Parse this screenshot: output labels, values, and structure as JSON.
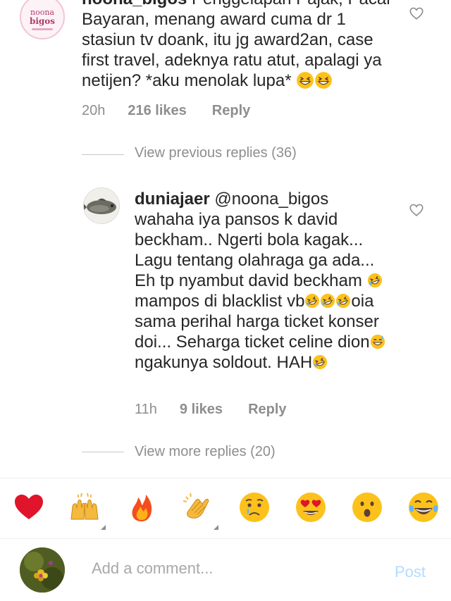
{
  "comment1": {
    "username": "noona_bigos",
    "avatar_text_top": "noona",
    "avatar_text_bottom": "bigos",
    "text": " Penggelapan Pajak, Pacar Bayaran, menang award cuma dr 1 stasiun tv doank, itu jg award2an, case first travel, adeknya ratu atut, apalagi ya netijen? *aku menolak lupa* ",
    "emojis": [
      "grinning-squint-face",
      "grinning-squint-face"
    ],
    "time": "20h",
    "likes": "216 likes",
    "reply": "Reply"
  },
  "view_previous": "View previous replies (36)",
  "reply1": {
    "username": "duniajaer",
    "mention": "@noona_bigos",
    "seg1": "wahaha iya pansos k david beckham.. Ngerti bola kagak... Lagu tentang olahraga ga ada... Eh tp nyambut david beckham ",
    "seg2": " mampos di blacklist vb",
    "seg3": "oia sama perihal harga ticket konser doi... Seharga ticket celine dion",
    "seg4": " ngakunya soldout.  HAH",
    "time": "11h",
    "likes": "9 likes",
    "reply": "Reply"
  },
  "view_more": "View more replies (20)",
  "reactions": [
    {
      "name": "red-heart",
      "has_variants": false
    },
    {
      "name": "raising-hands",
      "has_variants": true
    },
    {
      "name": "fire",
      "has_variants": false
    },
    {
      "name": "clapping-hands",
      "has_variants": true
    },
    {
      "name": "crying-face",
      "has_variants": false
    },
    {
      "name": "heart-eyes-face",
      "has_variants": false
    },
    {
      "name": "surprised-face",
      "has_variants": false
    },
    {
      "name": "tears-of-joy-face",
      "has_variants": false
    }
  ],
  "composer": {
    "placeholder": "Add a comment...",
    "post_label": "Post"
  },
  "colors": {
    "text": "#262626",
    "secondary": "#8e8e8e",
    "post_disabled": "#b3dbff",
    "emoji_yellow": "#fcc21b"
  }
}
